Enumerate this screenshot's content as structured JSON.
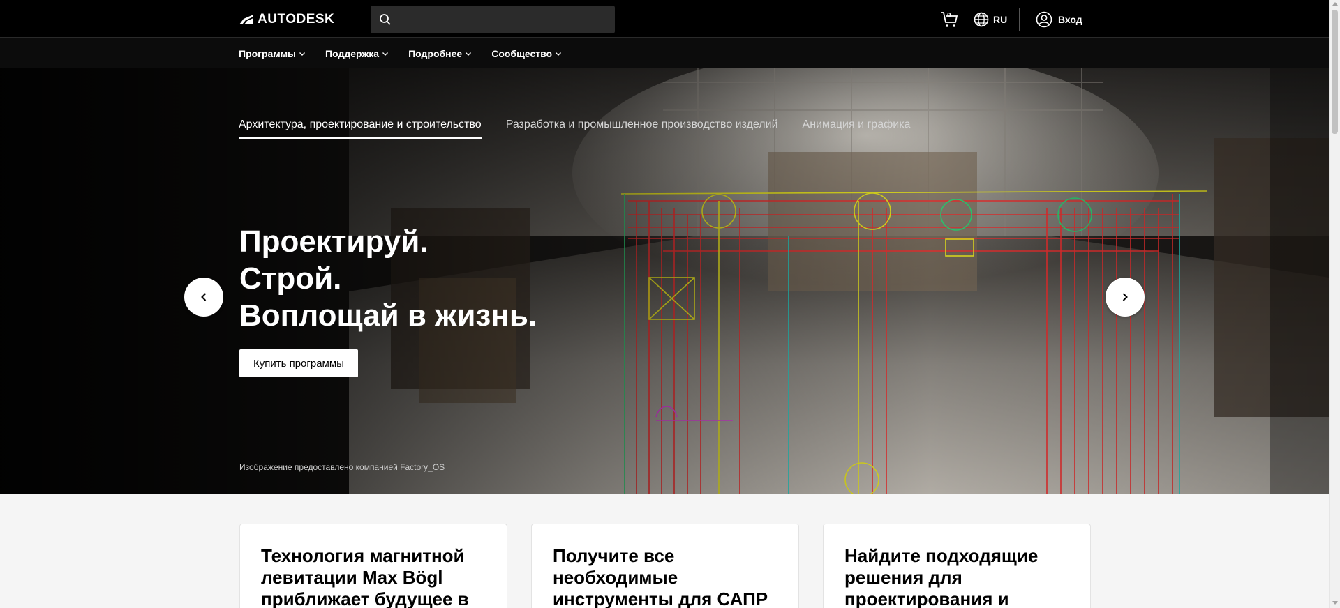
{
  "header": {
    "logo_text": "AUTODESK",
    "search_placeholder": "",
    "cart_count": "0",
    "language": "RU",
    "signin_label": "Вход"
  },
  "nav": {
    "items": [
      {
        "label": "Программы"
      },
      {
        "label": "Поддержка"
      },
      {
        "label": "Подробнее"
      },
      {
        "label": "Сообщество"
      }
    ]
  },
  "hero": {
    "tabs": [
      {
        "label": "Архитектура, проектирование и строительство",
        "active": true
      },
      {
        "label": "Разработка и промышленное производство изделий",
        "active": false
      },
      {
        "label": "Анимация и графика",
        "active": false
      }
    ],
    "headline": [
      "Проектируй.",
      "Строй.",
      "Воплощай в жизнь."
    ],
    "cta_label": "Купить программы",
    "caption": "Изображение предоставлено компанией Factory_OS"
  },
  "cards": [
    {
      "title": "Технология магнитной левитации Max Bögl приближает будущее в"
    },
    {
      "title": "Получите все необходимые инструменты для САПР"
    },
    {
      "title": "Найдите подходящие решения для проектирования и"
    }
  ],
  "icons": {
    "logo": "autodesk-logo-icon",
    "search": "search-icon",
    "cart": "cart-icon",
    "globe": "globe-icon",
    "user": "user-circle-icon",
    "chevron": "chevron-down-icon",
    "prev": "chevron-left-icon",
    "next": "chevron-right-icon"
  }
}
